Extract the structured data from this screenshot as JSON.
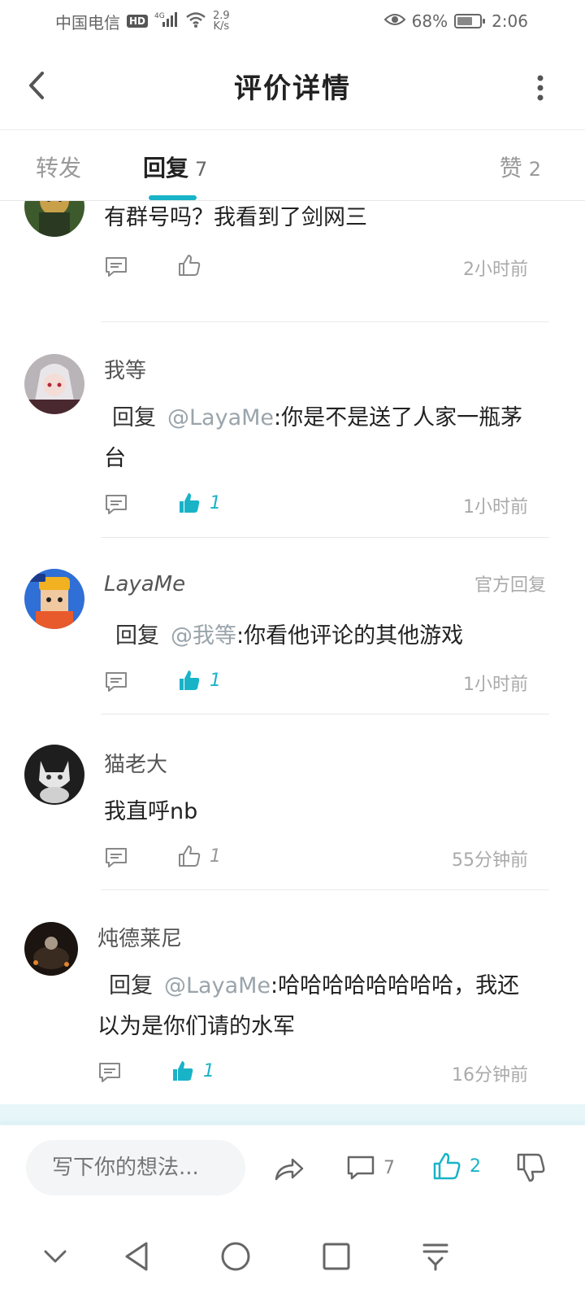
{
  "status_bar": {
    "carrier": "中国电信",
    "hd": "HD",
    "network": "4G",
    "speed_value": "2.9",
    "speed_unit": "K/s",
    "battery": "68%",
    "battery_level": 0.68,
    "time": "2:06"
  },
  "header": {
    "title": "评价详情"
  },
  "tabs": [
    {
      "label": "转发",
      "count": ""
    },
    {
      "label": "回复",
      "count": "7",
      "active": true
    },
    {
      "label": "赞",
      "count": "2"
    }
  ],
  "comments": [
    {
      "user": "",
      "text": "有群号吗？我看到了剑网三",
      "likes": "",
      "liked": false,
      "time": "2小时前"
    },
    {
      "user": "我等",
      "reply_prefix": "回复",
      "mention": "@LayaMe",
      "text": ":你是不是送了人家一瓶茅台",
      "likes": "1",
      "liked": true,
      "time": "1小时前"
    },
    {
      "user": "LayaMe",
      "badge": "官方回复",
      "reply_prefix": "回复",
      "mention": "@我等",
      "text": ":你看他评论的其他游戏",
      "likes": "1",
      "liked": true,
      "time": "1小时前"
    },
    {
      "user": "猫老大",
      "text": "我直呼nb",
      "likes": "1",
      "liked": false,
      "time": "55分钟前"
    },
    {
      "user": "炖德莱尼",
      "reply_prefix": "回复",
      "mention": "@LayaMe",
      "text": ":哈哈哈哈哈哈哈哈，我还以为是你们请的水军",
      "likes": "1",
      "liked": true,
      "time": "16分钟前"
    }
  ],
  "bottom_bar": {
    "placeholder": "写下你的想法...",
    "comment_count": "7",
    "like_count": "2"
  },
  "colors": {
    "accent": "#19b3c8",
    "muted": "#999999"
  }
}
